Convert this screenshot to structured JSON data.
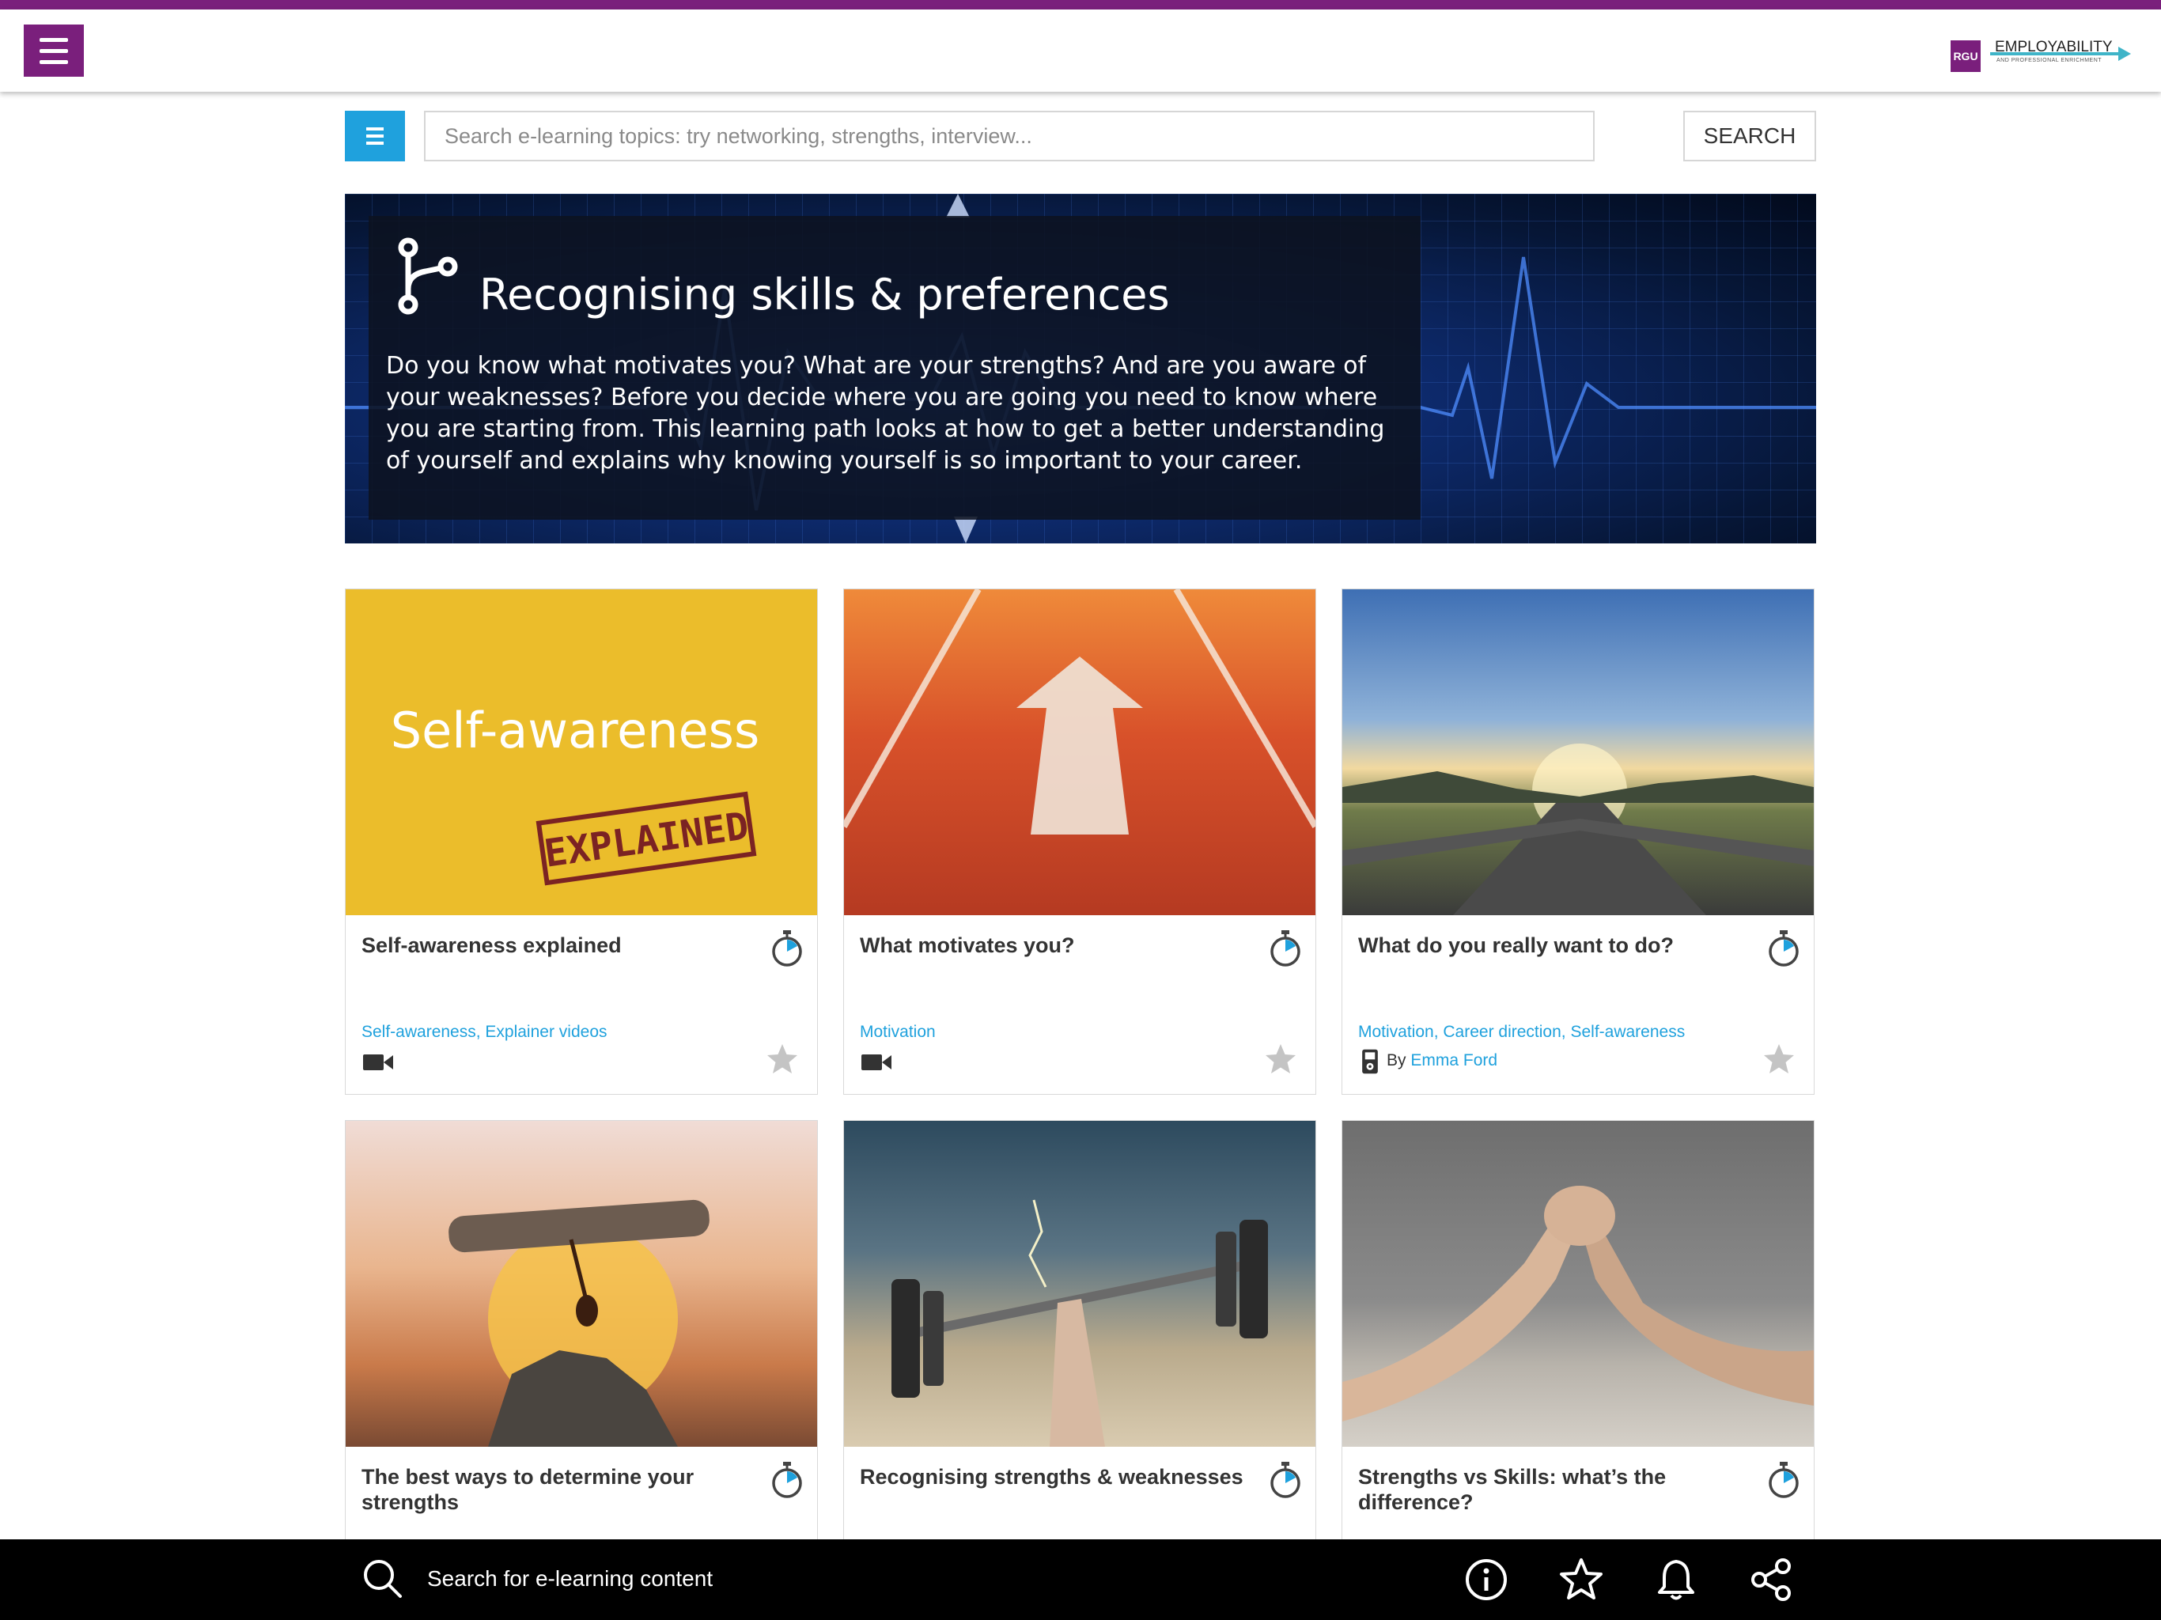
{
  "header": {
    "menu_icon": "hamburger-icon",
    "logo": {
      "mark": "RGU",
      "title": "EMPLOYABILITY",
      "subtitle": "AND PROFESSIONAL ENRICHMENT",
      "brand_color": "#7a1f7c",
      "accent_color": "#3fb4c8"
    }
  },
  "search": {
    "list_icon": "list-icon",
    "placeholder": "Search e-learning topics: try networking, strengths, interview...",
    "value": "",
    "button_label": "SEARCH",
    "list_button_color": "#1fa1dd"
  },
  "hero": {
    "icon": "learning-path-icon",
    "title": "Recognising skills & preferences",
    "description": "Do you know what motivates you? What are your strengths? And are you aware of your weaknesses? Before you decide where you are going you need to know where you are starting from. This learning path looks at how to get a better understanding of yourself and explains why knowing yourself is so important to your career."
  },
  "cards": [
    {
      "title": "Self-awareness explained",
      "image_text_main": "Self-awareness",
      "image_text_stamp": "EXPLAINED",
      "tags": [
        "Self-awareness",
        "Explainer videos"
      ],
      "type_icon": "video-icon",
      "timer_icon": "stopwatch-icon",
      "favourite_icon": "star-icon"
    },
    {
      "title": "What motivates you?",
      "tags": [
        "Motivation"
      ],
      "type_icon": "video-icon",
      "timer_icon": "stopwatch-icon",
      "favourite_icon": "star-icon"
    },
    {
      "title": "What do you really want to do?",
      "tags": [
        "Motivation",
        "Career direction",
        "Self-awareness"
      ],
      "type_icon": "audio-player-icon",
      "author_prefix": "By",
      "author": "Emma Ford",
      "timer_icon": "stopwatch-icon",
      "favourite_icon": "star-icon"
    },
    {
      "title": "The best ways to determine your strengths",
      "timer_icon": "stopwatch-icon"
    },
    {
      "title": "Recognising strengths & weaknesses",
      "timer_icon": "stopwatch-icon"
    },
    {
      "title": "Strengths vs Skills: what’s the difference?",
      "timer_icon": "stopwatch-icon"
    }
  ],
  "bottom_bar": {
    "search_icon": "search-icon",
    "search_text": "Search for e-learning content",
    "icons": [
      "info-icon",
      "star-icon",
      "bell-icon",
      "share-icon"
    ]
  }
}
